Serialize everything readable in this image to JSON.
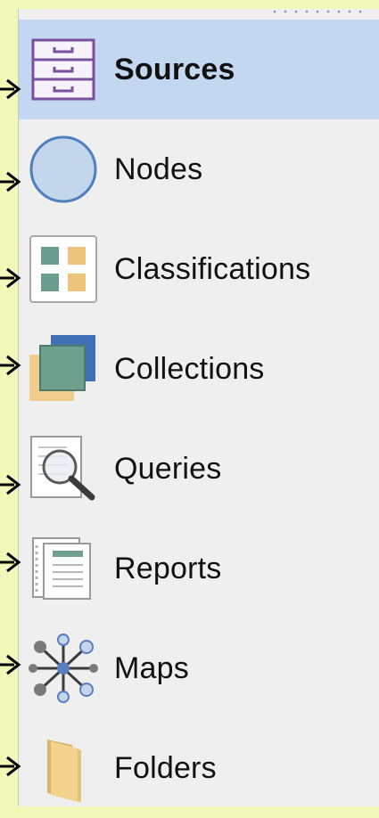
{
  "navigation": {
    "items": [
      {
        "label": "Sources",
        "icon": "file-cabinet-icon",
        "selected": true
      },
      {
        "label": "Nodes",
        "icon": "circle-node-icon",
        "selected": false
      },
      {
        "label": "Classifications",
        "icon": "classification-grid-icon",
        "selected": false
      },
      {
        "label": "Collections",
        "icon": "collection-squares-icon",
        "selected": false
      },
      {
        "label": "Queries",
        "icon": "query-magnifier-icon",
        "selected": false
      },
      {
        "label": "Reports",
        "icon": "report-document-icon",
        "selected": false
      },
      {
        "label": "Maps",
        "icon": "network-map-icon",
        "selected": false
      },
      {
        "label": "Folders",
        "icon": "folder-icon",
        "selected": false
      }
    ]
  },
  "colors": {
    "background": "#f2f8b9",
    "panel": "#efefef",
    "selected": "#c4d7f1"
  }
}
